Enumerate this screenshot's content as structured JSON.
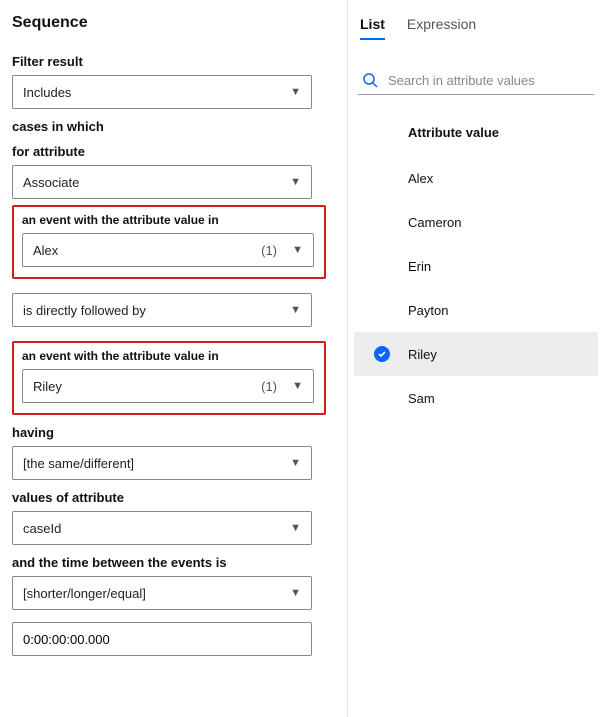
{
  "left": {
    "title": "Sequence",
    "filter_result_label": "Filter result",
    "filter_result_value": "Includes",
    "cases_in_which": "cases in which",
    "for_attribute_label": "for attribute",
    "for_attribute_value": "Associate",
    "event1_label": "an event with the attribute value in",
    "event1_value": "Alex",
    "event1_count": "(1)",
    "followed_by_value": "is directly followed by",
    "event2_label": "an event with the attribute value in",
    "event2_value": "Riley",
    "event2_count": "(1)",
    "having_label": "having",
    "having_value": "[the same/different]",
    "values_of_attribute_label": "values of attribute",
    "values_of_attribute_value": "caseId",
    "time_between_label": "and the time between the events is",
    "time_between_value": "[shorter/longer/equal]",
    "duration_value": "0:00:00:00.000"
  },
  "right": {
    "tabs": {
      "list": "List",
      "expression": "Expression"
    },
    "search_placeholder": "Search in attribute values",
    "attr_header": "Attribute value",
    "items": [
      {
        "label": "Alex",
        "selected": false
      },
      {
        "label": "Cameron",
        "selected": false
      },
      {
        "label": "Erin",
        "selected": false
      },
      {
        "label": "Payton",
        "selected": false
      },
      {
        "label": "Riley",
        "selected": true
      },
      {
        "label": "Sam",
        "selected": false
      }
    ]
  }
}
